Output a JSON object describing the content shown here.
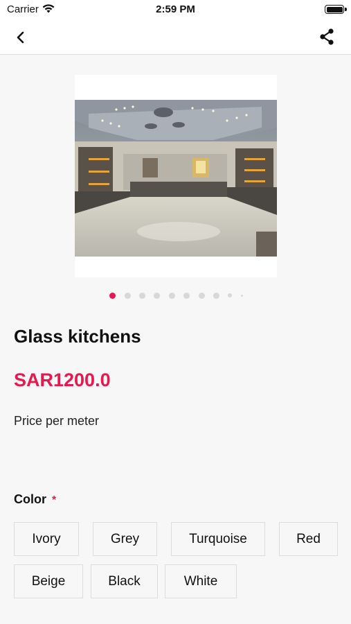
{
  "status_bar": {
    "carrier": "Carrier",
    "time": "2:59 PM"
  },
  "nav": {
    "back_icon": "chevron-left-icon",
    "share_icon": "share-icon"
  },
  "gallery": {
    "image_count": 10,
    "active_index": 0
  },
  "product": {
    "title": "Glass kitchens",
    "price": "SAR1200.0",
    "description": "Price per meter"
  },
  "color": {
    "label": "Color",
    "required_mark": "*",
    "options": [
      "Ivory",
      "Grey",
      "Turquoise",
      "Red",
      "Beige",
      "Black",
      "White"
    ]
  },
  "colors": {
    "accent": "#e8184f",
    "background": "#f7f7f7"
  }
}
